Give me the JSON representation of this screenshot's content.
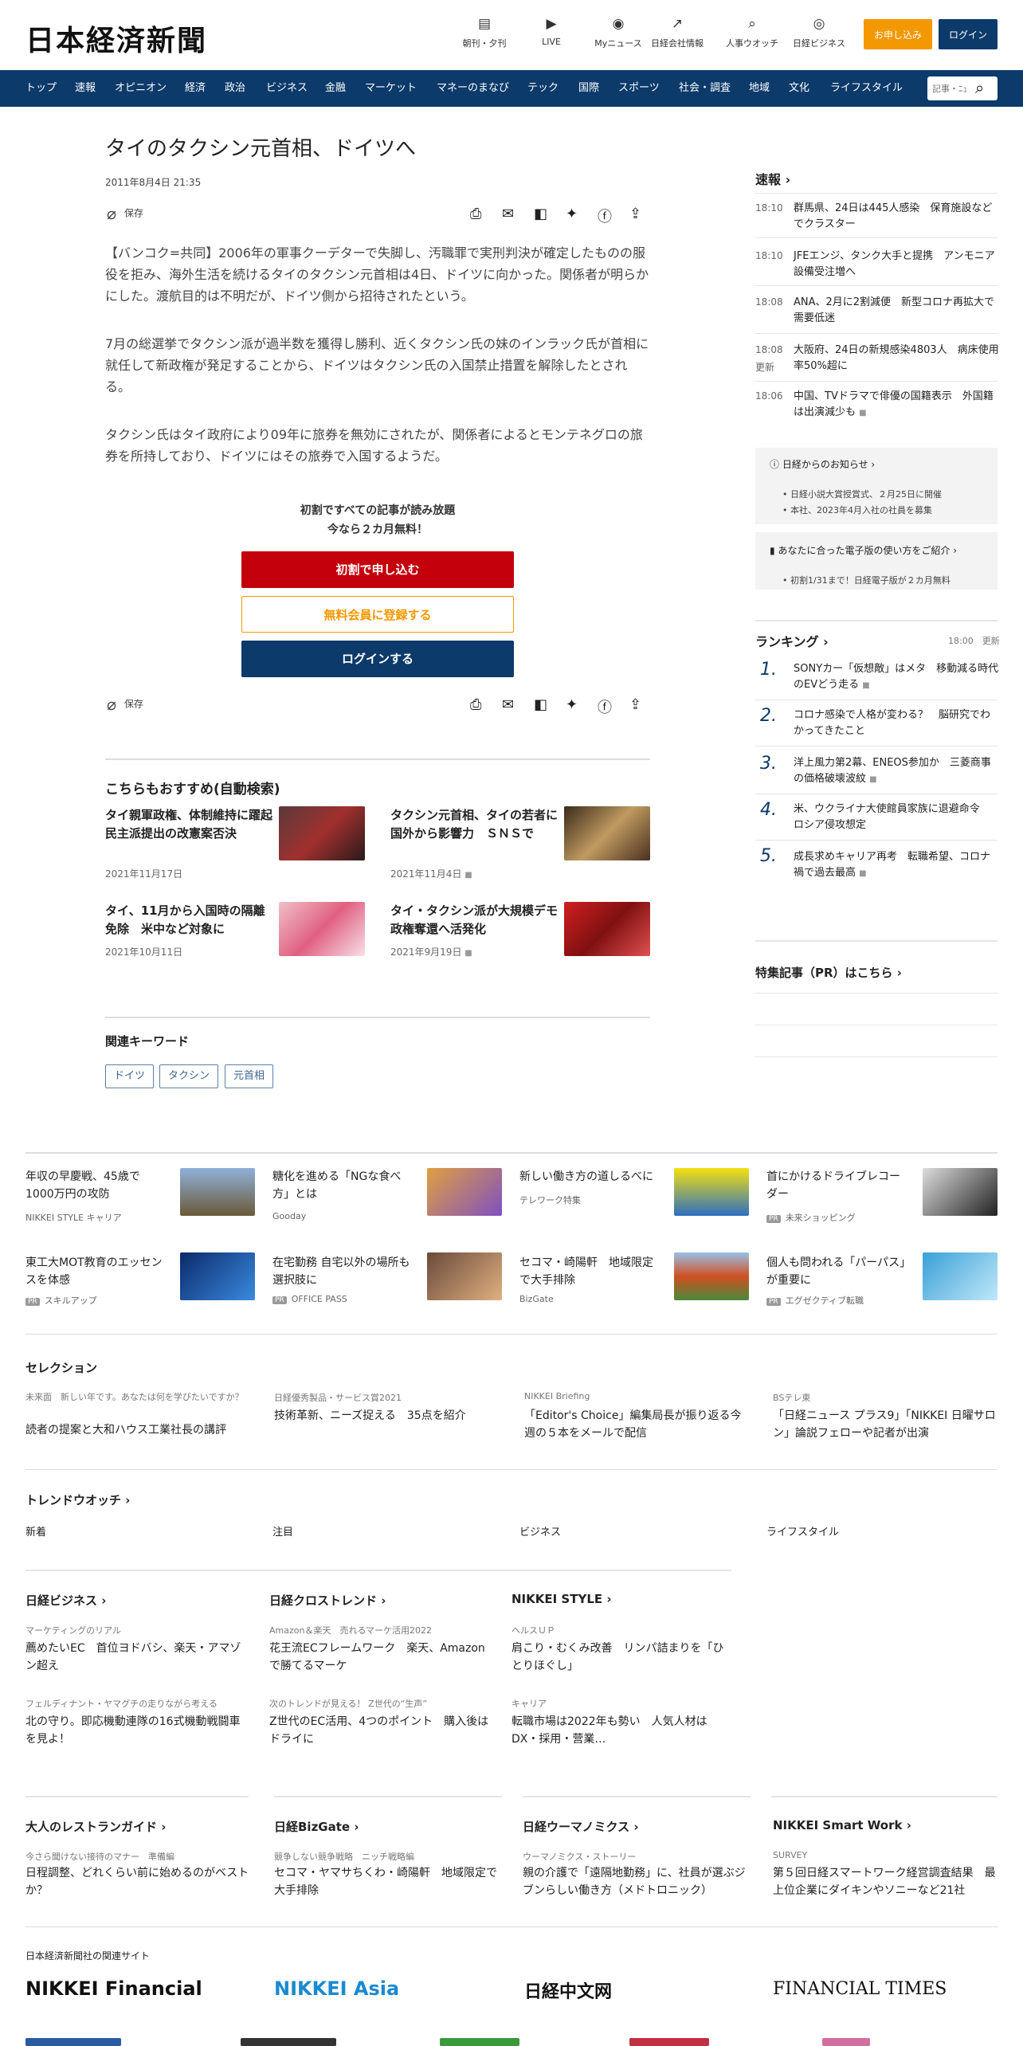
{
  "header": {
    "logo": "日本経済新聞",
    "tools": [
      {
        "icon": "newspaper-icon",
        "label": "朝刊・夕刊"
      },
      {
        "icon": "video-icon",
        "label": "LIVE"
      },
      {
        "icon": "user-icon",
        "label": "Myニュース"
      },
      {
        "icon": "chart-icon",
        "label": "日経会社情報"
      },
      {
        "icon": "search-person-icon",
        "label": "人事ウオッチ"
      },
      {
        "icon": "compass-icon",
        "label": "日経ビジネス"
      }
    ],
    "apply_label": "お申し込み",
    "login_label": "ログイン"
  },
  "nav": {
    "items": [
      "トップ",
      "速報",
      "オピニオン",
      "経済",
      "政治",
      "ビジネス",
      "金融",
      "マーケット",
      "マネーのまなび",
      "テック",
      "国際",
      "スポーツ",
      "社会・調査",
      "地域",
      "文化",
      "ライフスタイル"
    ],
    "search_placeholder": "記事・ﾆｭ"
  },
  "article": {
    "title": "タイのタクシン元首相、ドイツへ",
    "date": "2011年8月4日 21:35",
    "save_label": "保存",
    "paragraphs": [
      "【バンコク=共同】2006年の軍事クーデターで失脚し、汚職罪で実刑判決が確定したものの服役を拒み、海外生活を続けるタイのタクシン元首相は4日、ドイツに向かった。関係者が明らかにした。渡航目的は不明だが、ドイツ側から招待されたという。",
      "7月の総選挙でタクシン派が過半数を獲得し勝利、近くタクシン氏の妹のインラック氏が首相に就任して新政権が発足することから、ドイツはタクシン氏の入国禁止措置を解除したとされる。",
      "タクシン氏はタイ政府により09年に旅券を無効にされたが、関係者によるとモンテネグロの旅券を所持しており、ドイツにはその旅券で入国するようだ。"
    ],
    "promo_line1": "初割ですべての記事が読み放題",
    "promo_line2": "今なら２カ月無料！",
    "btn_subscribe": "初割で申し込む",
    "btn_register": "無料会員に登録する",
    "btn_login": "ログインする"
  },
  "recommend": {
    "heading": "こちらもおすすめ(自動検索)",
    "items": [
      {
        "title": "タイ親軍政権、体制維持に躍起　民主派提出の改憲案否決",
        "date": "2021年11月17日"
      },
      {
        "title": "タクシン元首相、タイの若者に国外から影響力　ＳＮＳで",
        "date": "2021年11月4日"
      },
      {
        "title": "タイ、11月から入国時の隔離免除　米中など対象に",
        "date": "2021年10月11日"
      },
      {
        "title": "タイ・タクシン派が大規模デモ　政権奪還へ活発化",
        "date": "2021年9月19日"
      }
    ]
  },
  "keywords": {
    "heading": "関連キーワード",
    "items": [
      "ドイツ",
      "タクシン",
      "元首相"
    ]
  },
  "sidebar": {
    "news_heading": "速報",
    "news": [
      {
        "time": "18:10",
        "title": "群馬県、24日は445人感染　保育施設などでクラスター"
      },
      {
        "time": "18:10",
        "title": "JFEエンジ、タンク大手と提携　アンモニア設備受注増へ"
      },
      {
        "time": "18:08",
        "title": "ANA、2月に2割減便　新型コロナ再拡大で需要低迷"
      },
      {
        "time": "18:08",
        "extra": "更新",
        "title": "大阪府、24日の新規感染4803人　病床使用率50%超に"
      },
      {
        "time": "18:06",
        "title": "中国、TVドラマで俳優の国籍表示　外国籍は出演減少も"
      }
    ],
    "notice_heading": "日経からのお知らせ",
    "notices": [
      "日経小説大賞授賞式、２月25日に開催",
      "本社、2023年4月入社の社員を募集"
    ],
    "guide_heading": "あなたに合った電子版の使い方をご紹介",
    "guides": [
      "初割1/31まで！日経電子版が２カ月無料"
    ],
    "ranking_heading": "ランキング",
    "ranking_time": "18:00",
    "ranking_update": "更新",
    "ranking": [
      "SONYカー「仮想敵」はメタ　移動減る時代のEVどう走る",
      "コロナ感染で人格が変わる？　脳研究でわかってきたこと",
      "洋上風力第2幕、ENEOS参加か　三菱商事の価格破壊波紋",
      "米、ウクライナ大使館員家族に退避命令　ロシア侵攻想定",
      "成長求めキャリア再考　転職希望、コロナ禍で過去最高"
    ],
    "pr_heading": "特集記事（PR）はこちら"
  },
  "ads": [
    {
      "title": "年収の早慶戦、45歳で1000万円の攻防",
      "source": "NIKKEI STYLE キャリア",
      "pr": false
    },
    {
      "title": "糖化を進める「NGな食べ方」とは",
      "source": "Gooday",
      "pr": false
    },
    {
      "title": "新しい働き方の道しるべに",
      "source": "テレワーク特集",
      "pr": false
    },
    {
      "title": "首にかけるドライブレコーダー",
      "source": "未来ショッピング",
      "pr": true
    },
    {
      "title": "東工大MOT教育のエッセンスを体感",
      "source": "スキルアップ",
      "pr": true
    },
    {
      "title": "在宅勤務 自宅以外の場所も選択肢に",
      "source": "OFFICE PASS",
      "pr": true
    },
    {
      "title": "セコマ・崎陽軒　地域限定で大手排除",
      "source": "BizGate",
      "pr": false
    },
    {
      "title": "個人も問われる「パーパス」が重要に",
      "source": "エグゼクティブ転職",
      "pr": true
    }
  ],
  "selection": {
    "heading": "セレクション",
    "items": [
      {
        "sub": "未来面　新しい年です。あなたは何を学びたいですか？",
        "title": "読者の提案と大和ハウス工業社長の講評"
      },
      {
        "sub": "日経優秀製品・サービス賞2021",
        "title": "技術革新、ニーズ捉える　35点を紹介"
      },
      {
        "sub": "NIKKEI Briefing",
        "title": "「Editor's Choice」編集局長が振り返る今週の５本をメールで配信"
      },
      {
        "sub": "BSテレ東",
        "title": "「日経ニュース プラス9」「NIKKEI 日曜サロン」論説フェローや記者が出演"
      }
    ]
  },
  "trend": {
    "heading": "トレンドウオッチ",
    "tabs": [
      "新着",
      "注目",
      "ビジネス",
      "ライフスタイル"
    ]
  },
  "groups": [
    {
      "heading": "日経ビジネス",
      "items": [
        {
          "sub": "マーケティングのリアル",
          "title": "薦めたいEC　首位ヨドバシ、楽天・アマゾン超え"
        },
        {
          "sub": "フェルディナント・ヤマグチの走りながら考える",
          "title": "北の守り。即応機動連隊の16式機動戦闘車を見よ！"
        }
      ]
    },
    {
      "heading": "日経クロストレンド",
      "items": [
        {
          "sub": "Amazon＆楽天　売れるマーケ活用2022",
          "title": "花王流ECフレームワーク　楽天、Amazonで勝てるマーケ"
        },
        {
          "sub": "次のトレンドが見える！ Z世代の“生声”",
          "title": "Z世代のEC活用、4つのポイント　購入後はドライに"
        }
      ]
    },
    {
      "heading": "NIKKEI STYLE",
      "items": [
        {
          "sub": "ヘルスＵＰ",
          "title": "肩こり・むくみ改善　リンパ詰まりを「ひとりほぐし」"
        },
        {
          "sub": "キャリア",
          "title": "転職市場は2022年も勢い　人気人材はDX・採用・营業…"
        }
      ]
    }
  ],
  "groups2": [
    {
      "heading": "大人のレストランガイド",
      "sub": "今さら聞けない接待のマナー　準備編",
      "title": "日程調整、どれくらい前に始めるのがベスト か？"
    },
    {
      "heading": "日経BizGate",
      "sub": "競争しない競争戦略　ニッチ戦略編",
      "title": "セコマ・ヤマサちくわ・崎陽軒　地域限定で大手排除"
    },
    {
      "heading": "日経ウーマノミクス",
      "sub": "ウーマノミクス・ストーリー",
      "title": "親の介護で「遠隔地勤務」に、社員が選ぶジブンらしい働き方（メドトロニック）"
    },
    {
      "heading": "NIKKEI Smart Work",
      "sub": "SURVEY",
      "title": "第５回日経スマートワーク経営調査結果　最上位企業にダイキンやソニーなど21社"
    }
  ],
  "related": {
    "heading": "日本経済新聞社の関連サイト",
    "brands": [
      "NIKKEI Financial",
      "NIKKEI Asia",
      "日経中文网",
      "FINANCIAL TIMES"
    ]
  },
  "colors": {
    "navy": "#0c3a6a",
    "orange": "#f39800",
    "red": "#c4000d"
  }
}
